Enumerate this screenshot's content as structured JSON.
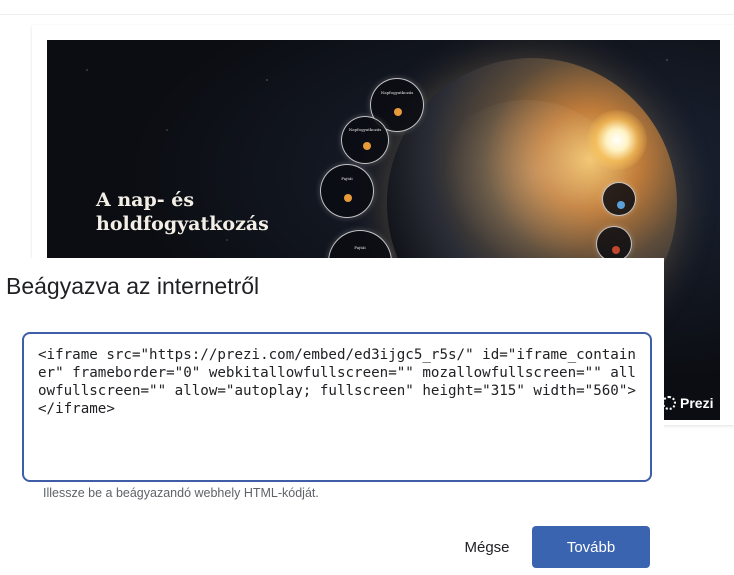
{
  "preview": {
    "slide_title": "A nap- és\nholdfogyatkozás",
    "bubbles": [
      {
        "text": "Napfogyatkozás"
      },
      {
        "text": "Napfogyatkozás"
      },
      {
        "text": "Fajtái"
      },
      {
        "text": "Fajtái"
      }
    ],
    "brand_label": "Prezi"
  },
  "dialog": {
    "title": "Beágyazva az internetről",
    "code_value": "<iframe src=\"https://prezi.com/embed/ed3ijgc5_r5s/\" id=\"iframe_container\" frameborder=\"0\" webkitallowfullscreen=\"\" mozallowfullscreen=\"\" allowfullscreen=\"\" allow=\"autoplay; fullscreen\" height=\"315\" width=\"560\"></iframe>",
    "hint": "Illessze be a beágyazandó webhely HTML-kódját.",
    "cancel_label": "Mégse",
    "next_label": "Tovább"
  },
  "colors": {
    "accent": "#3a64b0",
    "field_border": "#3f5ea8"
  }
}
